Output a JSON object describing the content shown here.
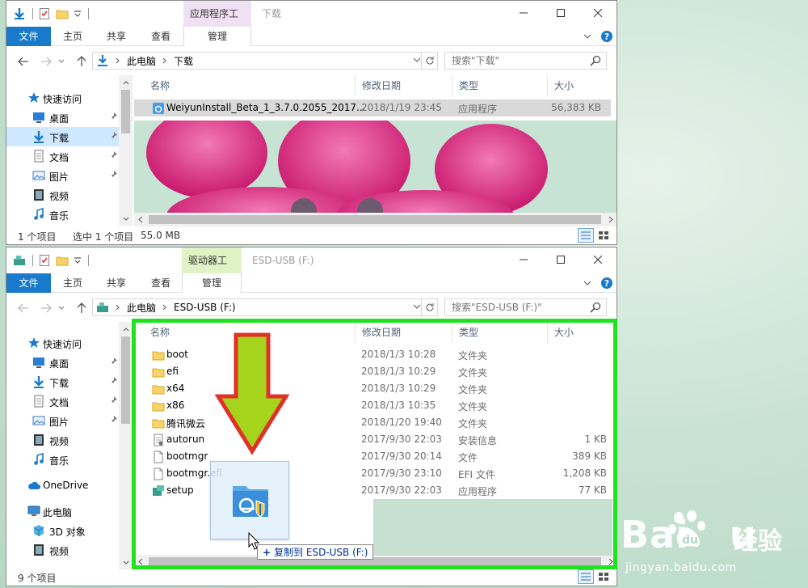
{
  "window1": {
    "context_tab": "应用程序工具",
    "title": "下载",
    "ribbon": {
      "file": "文件",
      "home": "主页",
      "share": "共享",
      "view": "查看",
      "manage": "管理"
    },
    "address": {
      "pc": "此电脑",
      "current": "下载"
    },
    "search_placeholder": "搜索\"下载\"",
    "nav": {
      "quick": "快速访问",
      "desktop": "桌面",
      "downloads": "下载",
      "documents": "文档",
      "pictures": "图片",
      "videos": "视频",
      "music": "音乐"
    },
    "columns": {
      "name": "名称",
      "date": "修改日期",
      "type": "类型",
      "size": "大小"
    },
    "files": [
      {
        "name": "WeiyunInstall_Beta_1_3.7.0.2055_2017...",
        "date": "2018/1/19 23:45",
        "type": "应用程序",
        "size": "56,383 KB"
      }
    ],
    "status": {
      "count": "1 个项目",
      "selected": "选中 1 个项目",
      "size": "55.0 MB"
    }
  },
  "window2": {
    "context_tab": "驱动器工具",
    "title": "ESD-USB (F:)",
    "ribbon": {
      "file": "文件",
      "home": "主页",
      "share": "共享",
      "view": "查看",
      "manage": "管理"
    },
    "address": {
      "pc": "此电脑",
      "current": "ESD-USB (F:)"
    },
    "search_placeholder": "搜索\"ESD-USB (F:)\"",
    "nav": {
      "quick": "快速访问",
      "desktop": "桌面",
      "downloads": "下载",
      "documents": "文档",
      "pictures": "图片",
      "videos": "视频",
      "music": "音乐",
      "onedrive": "OneDrive",
      "thispc": "此电脑",
      "objects3d": "3D 对象",
      "videos2": "视频"
    },
    "columns": {
      "name": "名称",
      "date": "修改日期",
      "type": "类型",
      "size": "大小"
    },
    "files": [
      {
        "name": "boot",
        "date": "2018/1/3 10:28",
        "type": "文件夹",
        "size": "",
        "icon": "folder-icon"
      },
      {
        "name": "efi",
        "date": "2018/1/3 10:29",
        "type": "文件夹",
        "size": "",
        "icon": "folder-icon"
      },
      {
        "name": "x64",
        "date": "2018/1/3 10:29",
        "type": "文件夹",
        "size": "",
        "icon": "folder-icon"
      },
      {
        "name": "x86",
        "date": "2018/1/3 10:35",
        "type": "文件夹",
        "size": "",
        "icon": "folder-icon"
      },
      {
        "name": "腾讯微云",
        "date": "2018/1/20 19:40",
        "type": "文件夹",
        "size": "",
        "icon": "folder-icon"
      },
      {
        "name": "autorun",
        "date": "2017/9/30 22:03",
        "type": "安装信息",
        "size": "1 KB",
        "icon": "setup-info-icon"
      },
      {
        "name": "bootmgr",
        "date": "2017/9/30 20:14",
        "type": "文件",
        "size": "389 KB",
        "icon": "file-icon"
      },
      {
        "name": "bootmgr.efi",
        "date": "2017/9/30 23:10",
        "type": "EFI 文件",
        "size": "1,208 KB",
        "icon": "file-icon"
      },
      {
        "name": "setup",
        "date": "2017/9/30 22:03",
        "type": "应用程序",
        "size": "77 KB",
        "icon": "setup-app-icon"
      }
    ],
    "status": {
      "count": "9 个项目"
    }
  },
  "drag": {
    "tooltip": "复制到 ESD-USB (F:)"
  },
  "watermark": {
    "brand": "Bai",
    "brand_end": "u",
    "cn": "经验",
    "url": "jingyan.baidu.com"
  },
  "colors": {
    "accent": "#1979ca",
    "highlight_frame": "#1ee31e",
    "arrow_fill": "#a6d41c",
    "arrow_stroke": "#e0302a"
  }
}
